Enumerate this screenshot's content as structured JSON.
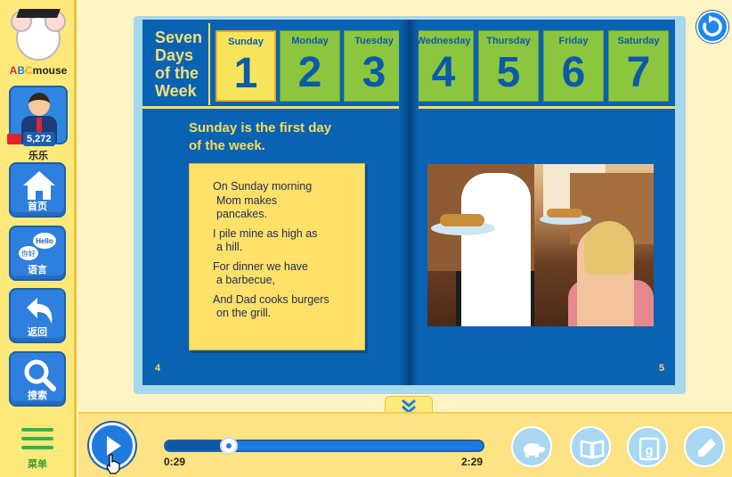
{
  "sidebar": {
    "logo": {
      "text_a": "A",
      "text_b": "B",
      "text_c": "C",
      "text_rest": "mouse"
    },
    "coins": "5,272",
    "username": "乐乐",
    "nav": [
      {
        "label": "首页",
        "icon": "home-icon"
      },
      {
        "label": "语言",
        "icon": "language-bubbles-icon",
        "bubble_zh": "你好",
        "bubble_en": "Hello"
      },
      {
        "label": "返回",
        "icon": "back-arrow-icon"
      },
      {
        "label": "搜索",
        "icon": "search-icon"
      }
    ],
    "menu_label": "菜单"
  },
  "book": {
    "title_lines": [
      "Seven",
      "Days",
      "of the",
      "Week"
    ],
    "days": [
      {
        "name": "Sunday",
        "num": "1"
      },
      {
        "name": "Monday",
        "num": "2"
      },
      {
        "name": "Tuesday",
        "num": "3"
      },
      {
        "name": "Wednesday",
        "num": "4"
      },
      {
        "name": "Thursday",
        "num": "5"
      },
      {
        "name": "Friday",
        "num": "6"
      },
      {
        "name": "Saturday",
        "num": "7"
      }
    ],
    "heading_line1": "Sunday is the first day",
    "heading_line2": "of the week.",
    "poem": [
      [
        "On Sunday morning",
        "Mom makes",
        "pancakes."
      ],
      [
        "I pile mine as high as",
        "a hill."
      ],
      [
        "For dinner we have",
        "a barbecue,"
      ],
      [
        "And Dad cooks burgers",
        "on the grill."
      ]
    ],
    "page_left": "4",
    "page_right": "5"
  },
  "player": {
    "current_time": "0:29",
    "total_time": "2:29",
    "progress": 0.2
  },
  "colors": {
    "accent_blue": "#1f7be0",
    "page_blue": "#0a62b3",
    "day_green": "#8cc63f",
    "active_yellow": "#f7e45a"
  }
}
